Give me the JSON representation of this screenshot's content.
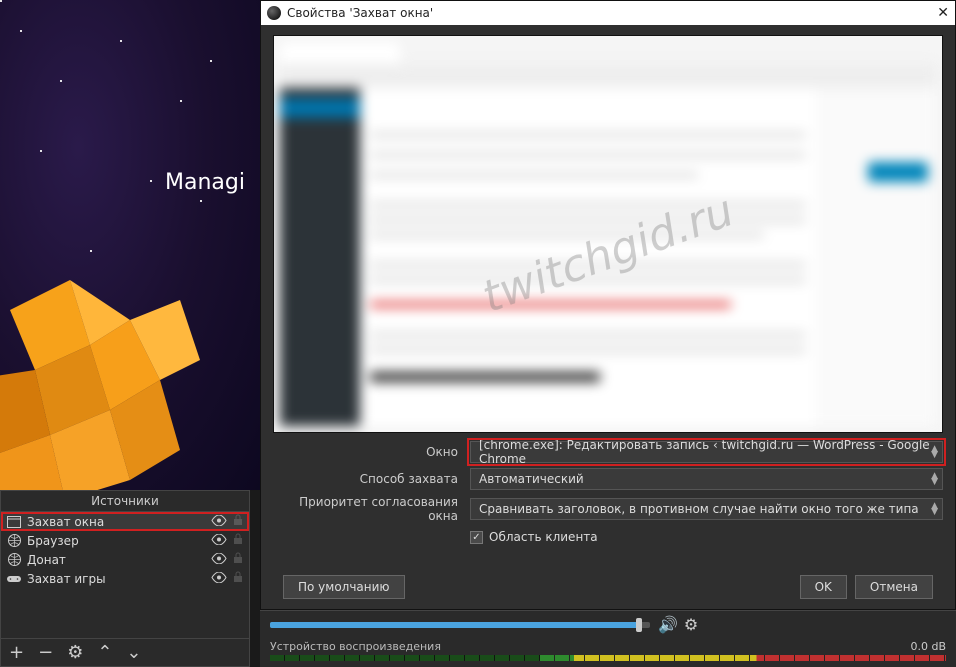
{
  "preview": {
    "text_overlay": "Managi"
  },
  "sources": {
    "header": "Источники",
    "items": [
      {
        "label": "Захват окна",
        "icon": "window-icon"
      },
      {
        "label": "Браузер",
        "icon": "globe-icon"
      },
      {
        "label": "Донат",
        "icon": "globe-icon"
      },
      {
        "label": "Захват игры",
        "icon": "gamepad-icon"
      }
    ],
    "toolbar": {
      "add": "+",
      "remove": "−",
      "settings": "⚙",
      "up": "⌃",
      "down": "⌄"
    }
  },
  "dialog": {
    "title": "Свойства 'Захват окна'",
    "watermark": "twitchgid.ru",
    "fields": {
      "window_label": "Окно",
      "window_value": "[chrome.exe]: Редактировать запись ‹ twitchgid.ru — WordPress - Google Chrome",
      "method_label": "Способ захвата",
      "method_value": "Автоматический",
      "priority_label": "Приоритет согласования окна",
      "priority_value": "Сравнивать заголовок, в противном случае найти окно того же типа",
      "client_area_label": "Область клиента",
      "client_area_checked": true
    },
    "buttons": {
      "defaults": "По умолчанию",
      "ok": "OK",
      "cancel": "Отмена"
    }
  },
  "mixer": {
    "device_label": "Устройство воспроизведения",
    "db_value": "0.0 dB"
  }
}
